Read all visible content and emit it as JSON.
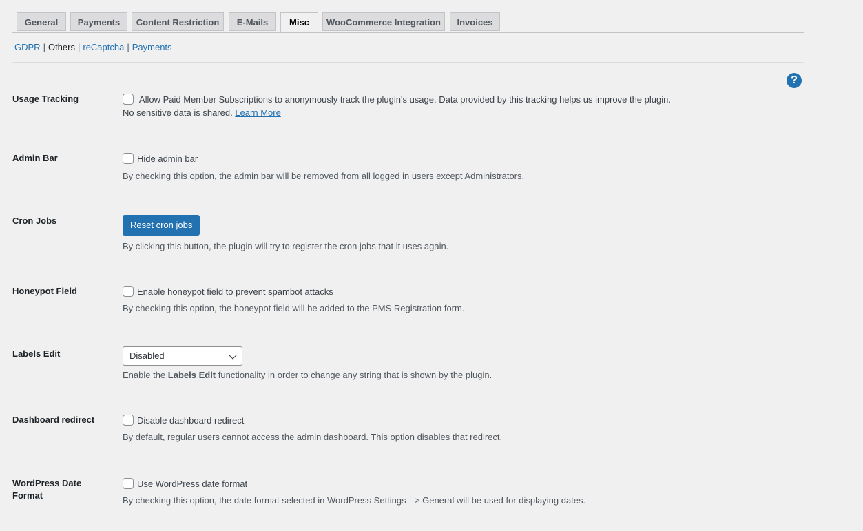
{
  "tabs": [
    "General",
    "Payments",
    "Content Restriction",
    "E-Mails",
    "Misc",
    "WooCommerce Integration",
    "Invoices"
  ],
  "subnav": {
    "gdpr": "GDPR",
    "others": "Others",
    "recaptcha": "reCaptcha",
    "payments": "Payments",
    "separator": "|"
  },
  "help_icon": "?",
  "usage_tracking": {
    "label": "Usage Tracking",
    "checkbox_label": "Allow Paid Member Subscriptions to anonymously track the plugin's usage. Data provided by this tracking helps us improve the plugin.",
    "line2": "No sensitive data is shared.",
    "learn_more": "Learn More"
  },
  "admin_bar": {
    "label": "Admin Bar",
    "checkbox_label": "Hide admin bar",
    "desc": "By checking this option, the admin bar will be removed from all logged in users except Administrators."
  },
  "cron_jobs": {
    "label": "Cron Jobs",
    "button": "Reset cron jobs",
    "desc": "By clicking this button, the plugin will try to register the cron jobs that it uses again."
  },
  "honeypot": {
    "label": "Honeypot Field",
    "checkbox_label": "Enable honeypot field to prevent spambot attacks",
    "desc": "By checking this option, the honeypot field will be added to the PMS Registration form."
  },
  "labels_edit": {
    "label": "Labels Edit",
    "selected": "Disabled",
    "desc_pre": "Enable the ",
    "desc_bold": "Labels Edit",
    "desc_post": " functionality in order to change any string that is shown by the plugin."
  },
  "dashboard_redirect": {
    "label": "Dashboard redirect",
    "checkbox_label": "Disable dashboard redirect",
    "desc": "By default, regular users cannot access the admin dashboard. This option disables that redirect."
  },
  "wp_date_format": {
    "label": "WordPress Date Format",
    "checkbox_label": "Use WordPress date format",
    "desc": "By checking this option, the date format selected in WordPress Settings --> General will be used for displaying dates."
  }
}
